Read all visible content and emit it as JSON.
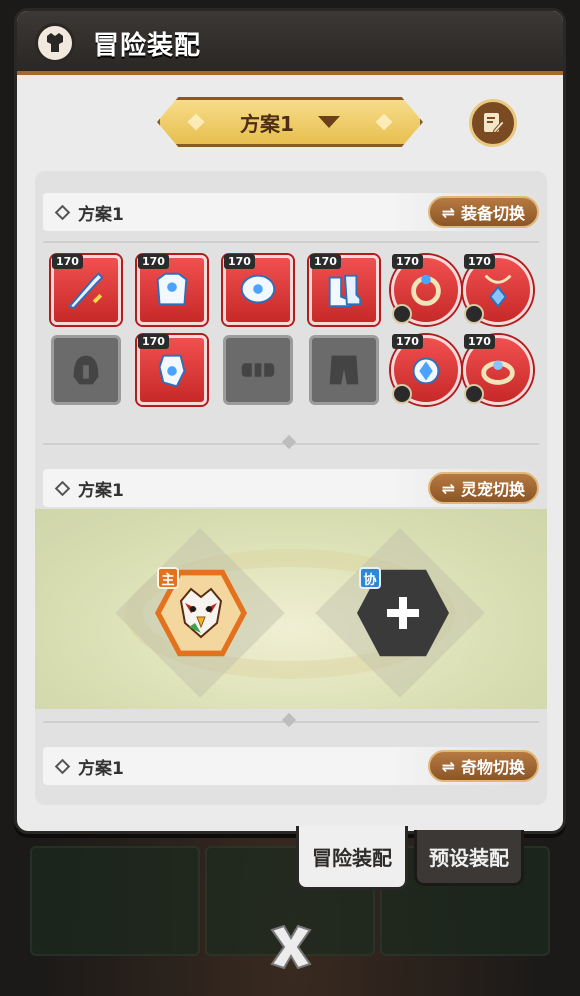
{
  "header": {
    "title": "冒险装配",
    "icon": "equipment-icon"
  },
  "scheme_selector": {
    "selected": "方案1"
  },
  "edit_button": {
    "icon": "edit-icon"
  },
  "equipment_section": {
    "title": "方案1",
    "switch_label": "装备切换",
    "slots": [
      {
        "level": "170",
        "item": "sword",
        "filled": true
      },
      {
        "level": "170",
        "item": "chest-armor",
        "filled": true
      },
      {
        "level": "170",
        "item": "shoulder-armor",
        "filled": true
      },
      {
        "level": "170",
        "item": "boots",
        "filled": true
      },
      {
        "level": "170",
        "item": "ring",
        "filled": true
      },
      {
        "level": "170",
        "item": "pendant",
        "filled": true
      },
      {
        "level": "",
        "item": "helmet",
        "filled": false
      },
      {
        "level": "170",
        "item": "gauntlet",
        "filled": true
      },
      {
        "level": "",
        "item": "belt",
        "filled": false
      },
      {
        "level": "",
        "item": "pants",
        "filled": false
      },
      {
        "level": "170",
        "item": "amulet",
        "filled": true
      },
      {
        "level": "170",
        "item": "bracelet",
        "filled": true
      }
    ]
  },
  "pet_section": {
    "title": "方案1",
    "switch_label": "灵宠切换",
    "main_tag": "主",
    "assist_tag": "协"
  },
  "artifact_section": {
    "title": "方案1",
    "switch_label": "奇物切换"
  },
  "tabs": {
    "active": "冒险装配",
    "inactive": "预设装配"
  },
  "colors": {
    "accent": "#a6672f",
    "slot_red": "#e23b3b",
    "main_pet": "#e2721d",
    "assist_pet": "#2e86d6"
  }
}
